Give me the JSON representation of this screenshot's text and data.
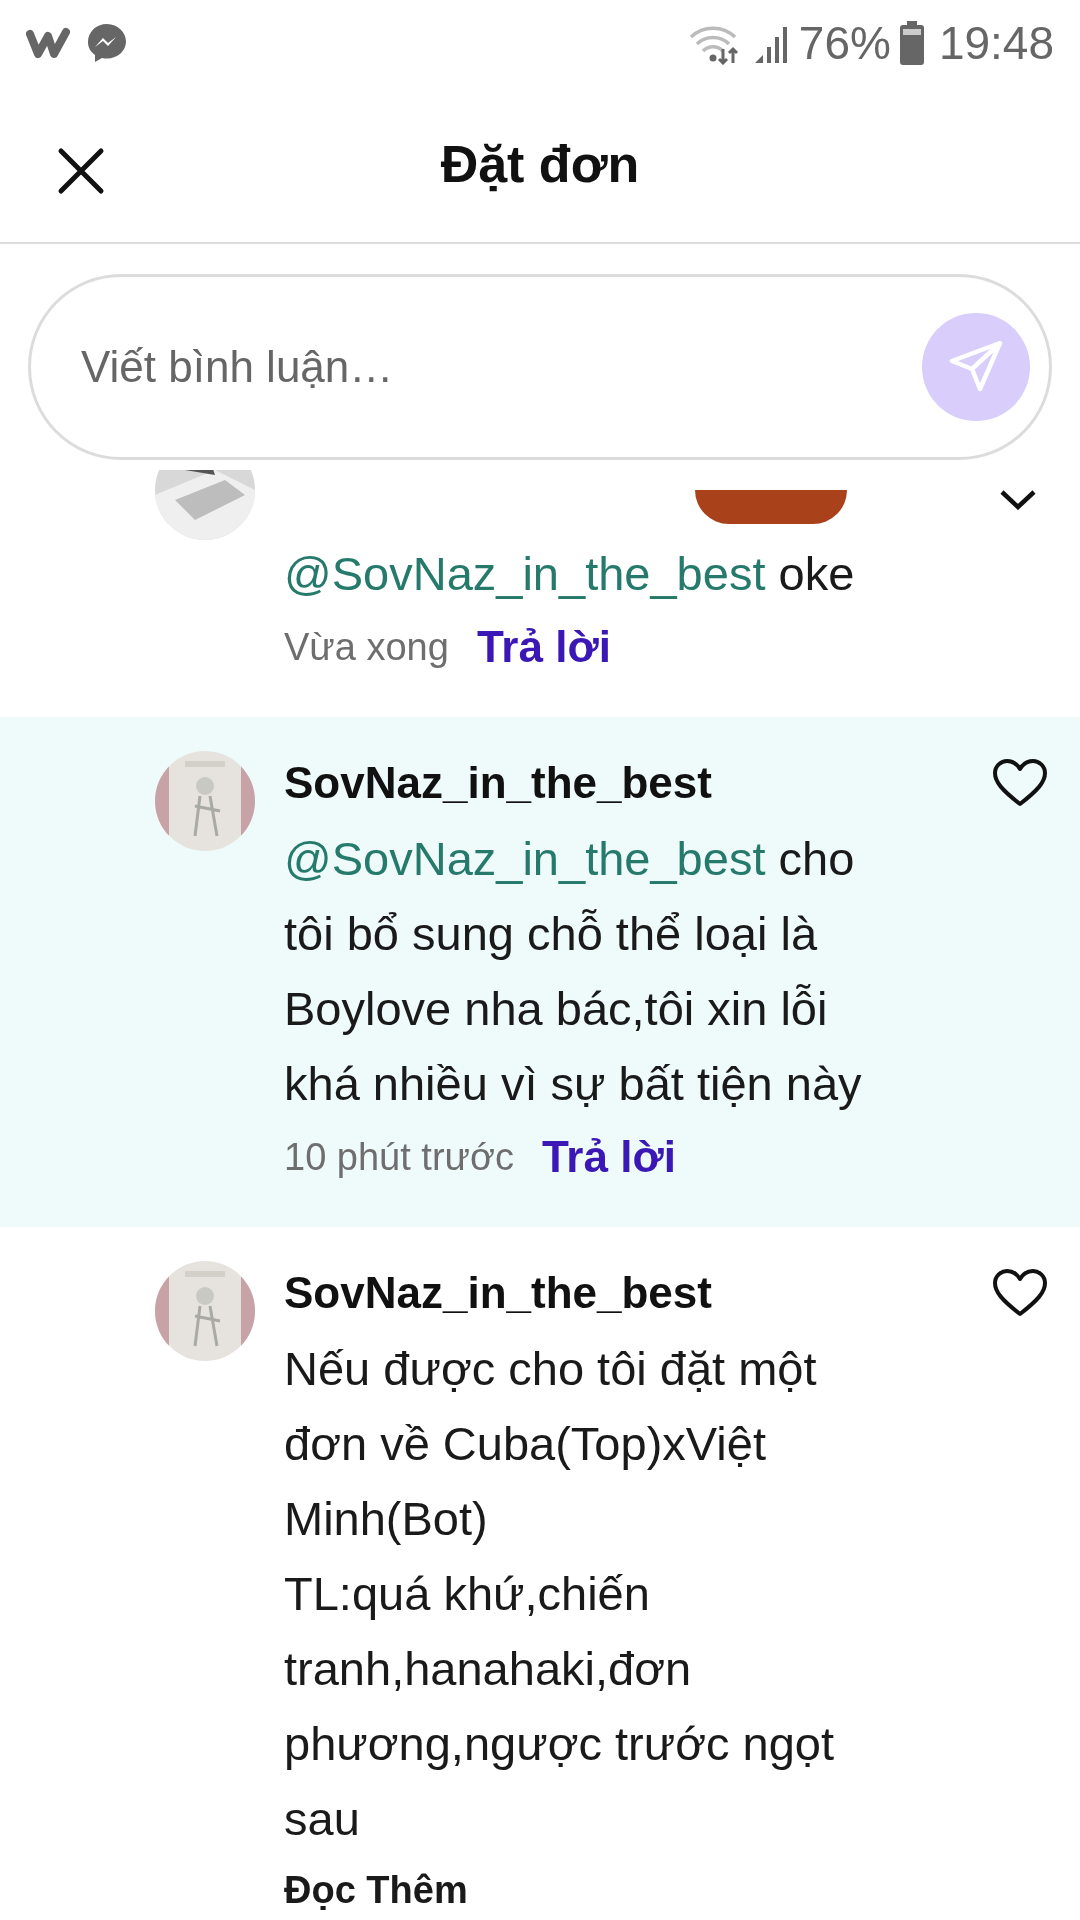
{
  "status_bar": {
    "battery": "76%",
    "time": "19:48"
  },
  "header": {
    "title": "Đặt đơn"
  },
  "comment_box": {
    "placeholder": "Viết bình luận…"
  },
  "comments": [
    {
      "mention": "@SovNaz_in_the_best",
      "text": "oke",
      "time": "Vừa xong",
      "reply": "Trả lời",
      "highlighted": false,
      "collapsible": true
    },
    {
      "author": "SovNaz_in_the_best",
      "mention": "@SovNaz_in_the_best",
      "text": "cho tôi bổ sung chỗ thể loại là Boylove nha bác,tôi xin lỗi khá nhiều vì sự bất tiện này",
      "time": "10 phút trước",
      "reply": "Trả lời",
      "highlighted": true,
      "collapsible": false
    },
    {
      "author": "SovNaz_in_the_best",
      "text": "Nếu được cho tôi đặt một đơn về Cuba(Top)xViệt Minh(Bot)\nTL:quá khứ,chiến tranh,hanahaki,đơn phương,ngược trước ngọt sau",
      "read_more": "Đọc Thêm",
      "highlighted": false,
      "collapsible": false
    }
  ]
}
